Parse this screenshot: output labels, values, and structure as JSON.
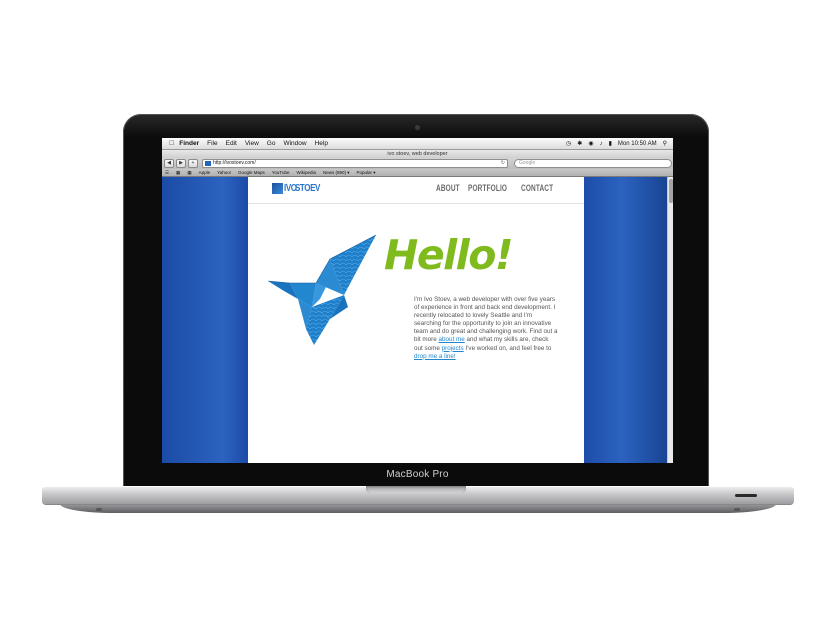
{
  "menubar": {
    "apple_icon": "apple-logo-icon",
    "app_name": "Finder",
    "items": [
      "File",
      "Edit",
      "View",
      "Go",
      "Window",
      "Help"
    ],
    "clock": "Mon 10:50 AM"
  },
  "browser": {
    "window_title": "ivo stoev, web developer",
    "url": "http://ivostoev.com/",
    "search_placeholder": "Google",
    "bookmarks": [
      "Apple",
      "Yahoo!",
      "Google Maps",
      "YouTube",
      "Wikipedia",
      "News (990) ▾",
      "Popular ▾"
    ]
  },
  "site": {
    "logo_part1": "IVO",
    "logo_part2": "STOEV",
    "nav": [
      "ABOUT",
      "PORTFOLIO",
      "CONTACT"
    ],
    "headline": "Hello!",
    "bio_before": "I'm Ivo Stoev, a web developer with over five years of experience in front and back end development. I recently relocated to lovely Seattle and I'm searching for the opportunity to join an innovative team and do great and challenging work. Find out a bit more ",
    "link_about": "about me",
    "bio_middle": " and what my skills are, check out some ",
    "link_projects": "projects",
    "bio_after": " I've worked on, and feel free to ",
    "link_contact": "drop me a line!",
    "colors": {
      "accent_green": "#7fbb1d",
      "link_blue": "#1f86d0",
      "logo_blue": "#2a75c9"
    }
  },
  "device": {
    "label": "MacBook Pro"
  }
}
